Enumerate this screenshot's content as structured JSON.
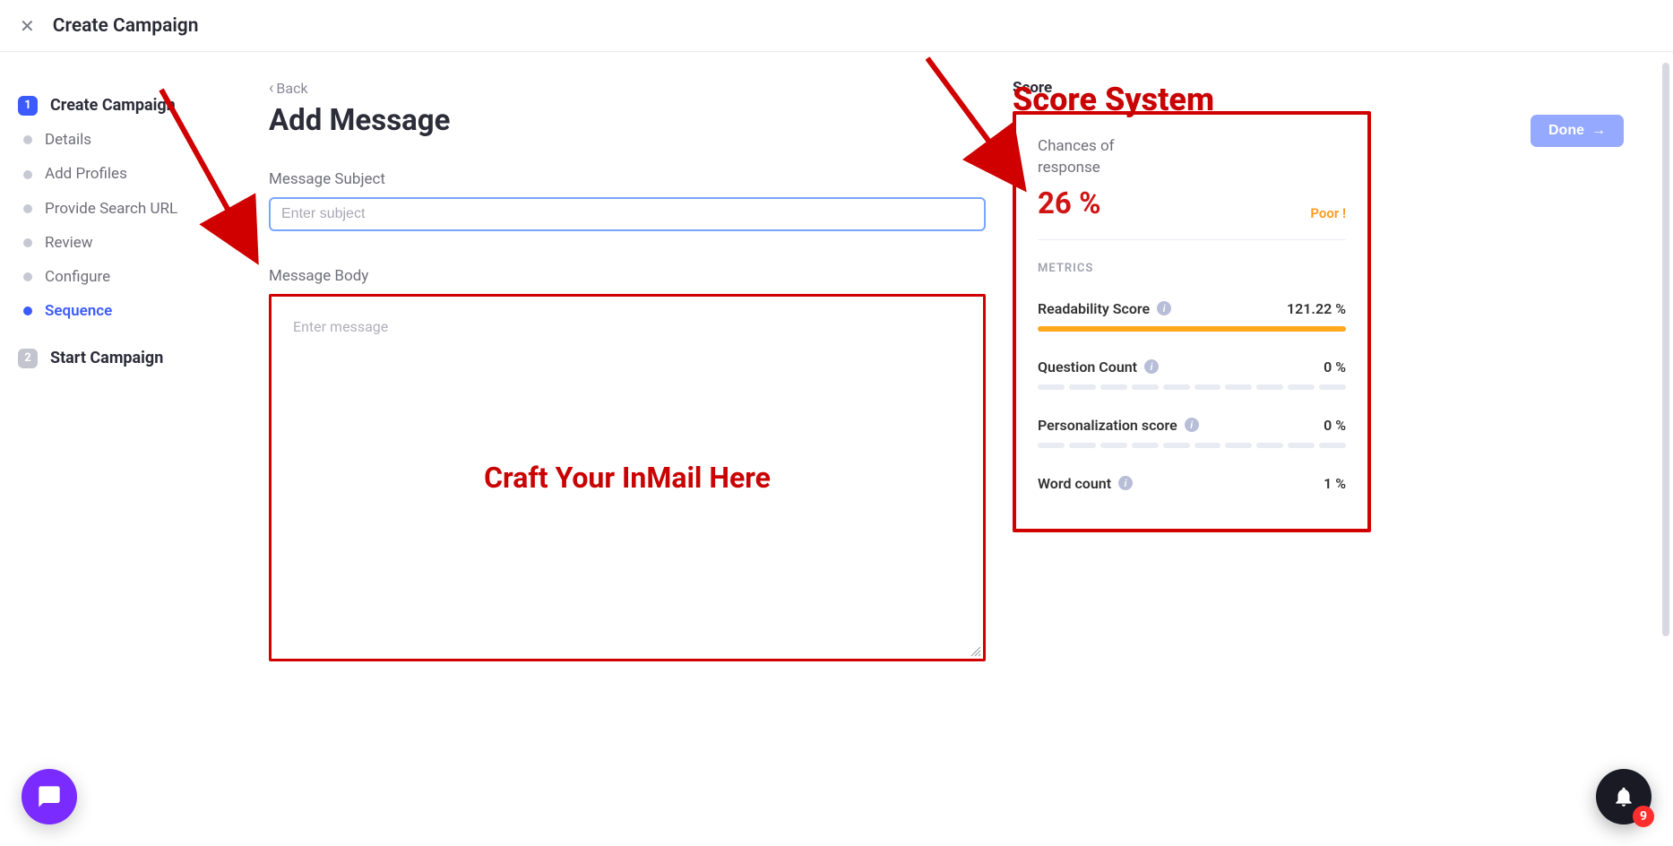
{
  "header": {
    "title": "Create Campaign"
  },
  "sidebar": {
    "main1": {
      "num": "1",
      "label": "Create Campaign"
    },
    "subs": [
      {
        "label": "Details"
      },
      {
        "label": "Add Profiles"
      },
      {
        "label": "Provide Search URL"
      },
      {
        "label": "Review"
      },
      {
        "label": "Configure"
      },
      {
        "label": "Sequence"
      }
    ],
    "main2": {
      "num": "2",
      "label": "Start Campaign"
    }
  },
  "form": {
    "back": "Back",
    "page_title": "Add Message",
    "subject_label": "Message Subject",
    "subject_placeholder": "Enter subject",
    "body_label": "Message Body",
    "body_placeholder": "Enter message",
    "done": "Done"
  },
  "score": {
    "heading": "Score",
    "chance_label": "Chances of response",
    "chance_value": "26 %",
    "rating": "Poor !",
    "metrics_label": "METRICS",
    "metrics": [
      {
        "name": "Readability Score",
        "value": "121.22 %",
        "style": "full"
      },
      {
        "name": "Question Count",
        "value": "0 %",
        "style": "seg"
      },
      {
        "name": "Personalization score",
        "value": "0 %",
        "style": "seg"
      },
      {
        "name": "Word count",
        "value": "1 %",
        "style": "seg"
      }
    ]
  },
  "annotations": {
    "score_system": "Score System",
    "craft": "Craft Your InMail Here"
  },
  "notif_count": "9"
}
